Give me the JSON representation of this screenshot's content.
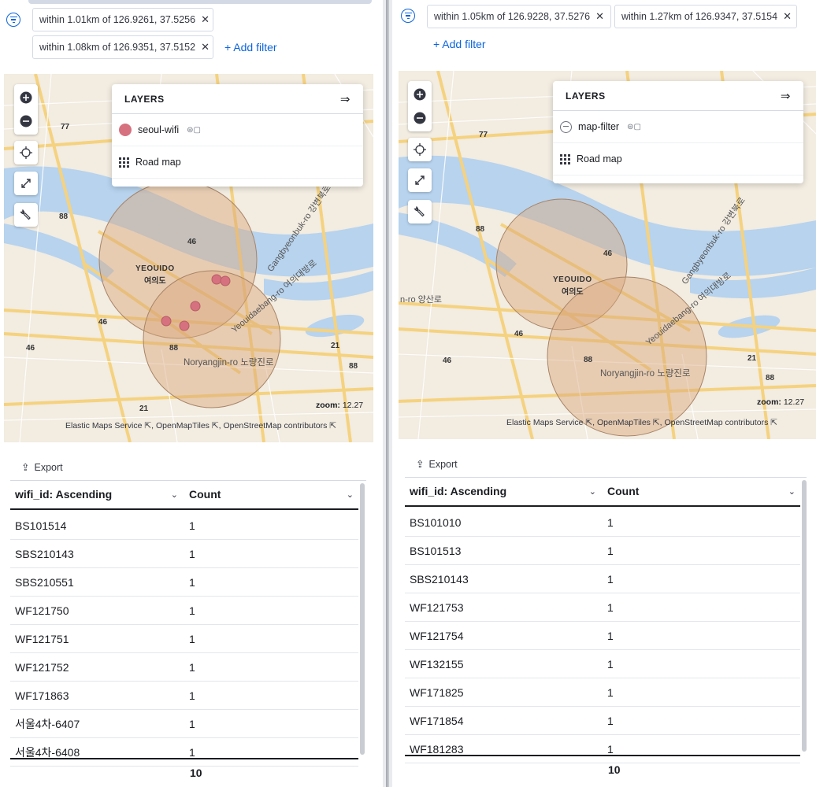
{
  "left": {
    "filters": [
      {
        "label": "within 1.01km of 126.9261, 37.5256"
      },
      {
        "label": "within 1.08km of 126.9351, 37.5152"
      }
    ],
    "add_filter": "+ Add filter",
    "layers_title": "LAYERS",
    "layers": [
      {
        "name": "seoul-wifi",
        "swatch_color": "#d6717f"
      },
      {
        "name": "Road map",
        "icon": "grid-icon"
      }
    ],
    "zoom_label": "zoom:",
    "zoom_value": "12.27",
    "attribution": [
      "Elastic Maps Service",
      "OpenMapTiles",
      "OpenStreetMap contributors"
    ],
    "map_labels": {
      "yeouido": "YEOUIDO",
      "yeouido_kr": "여의도",
      "noryangjin": "Noryangjin-ro 노량진로",
      "gangbyeon": "Gangbyeonbuk-ro 강변북로",
      "yeouidaebang": "Yeouidaebang-ro 여의대방로",
      "r77": "77",
      "r88a": "88",
      "r46a": "46",
      "r46b": "46",
      "r46c": "46",
      "r88b": "88",
      "r21a": "21",
      "r88c": "88",
      "r21b": "21"
    },
    "table": {
      "export": "Export",
      "col1": "wifi_id: Ascending",
      "col2": "Count",
      "rows": [
        {
          "id": "BS101514",
          "count": "1"
        },
        {
          "id": "SBS210143",
          "count": "1"
        },
        {
          "id": "SBS210551",
          "count": "1"
        },
        {
          "id": "WF121750",
          "count": "1"
        },
        {
          "id": "WF121751",
          "count": "1"
        },
        {
          "id": "WF121752",
          "count": "1"
        },
        {
          "id": "WF171863",
          "count": "1"
        },
        {
          "id": "서울4차-6407",
          "count": "1"
        },
        {
          "id": "서울4차-6408",
          "count": "1"
        }
      ],
      "total": "10"
    }
  },
  "right": {
    "filters": [
      {
        "label": "within 1.05km of 126.9228, 37.5276"
      },
      {
        "label": "within 1.27km of 126.9347, 37.5154"
      }
    ],
    "add_filter": "+ Add filter",
    "layers_title": "LAYERS",
    "layers": [
      {
        "name": "map-filter",
        "icon": "minus-circle-icon"
      },
      {
        "name": "Road map",
        "icon": "grid-icon"
      }
    ],
    "zoom_label": "zoom:",
    "zoom_value": "12.27",
    "attribution": [
      "Elastic Maps Service",
      "OpenMapTiles",
      "OpenStreetMap contributors"
    ],
    "map_labels": {
      "yeouido": "YEOUIDO",
      "yeouido_kr": "여의도",
      "noryangjin": "Noryangjin-ro 노량진로",
      "gangbyeon": "Gangbyeonbuk-ro 강변북로",
      "yeouidaebang": "Yeouidaebang-ro 여의대방로",
      "yangsan": "n-ro 양산로",
      "r77": "77",
      "r88a": "88",
      "r46a": "46",
      "r46b": "46",
      "r46c": "46",
      "r88b": "88",
      "r21a": "21",
      "r88c": "88"
    },
    "table": {
      "export": "Export",
      "col1": "wifi_id: Ascending",
      "col2": "Count",
      "rows": [
        {
          "id": "BS101010",
          "count": "1"
        },
        {
          "id": "BS101513",
          "count": "1"
        },
        {
          "id": "SBS210143",
          "count": "1"
        },
        {
          "id": "WF121753",
          "count": "1"
        },
        {
          "id": "WF121754",
          "count": "1"
        },
        {
          "id": "WF132155",
          "count": "1"
        },
        {
          "id": "WF171825",
          "count": "1"
        },
        {
          "id": "WF171854",
          "count": "1"
        },
        {
          "id": "WF181283",
          "count": "1"
        }
      ],
      "total": "10"
    }
  },
  "colors": {
    "accent": "#0b64dd",
    "river": "#b7d3ee",
    "road": "#f7d68a",
    "circle_fill": "#d9a679",
    "point": "#d6717f"
  }
}
